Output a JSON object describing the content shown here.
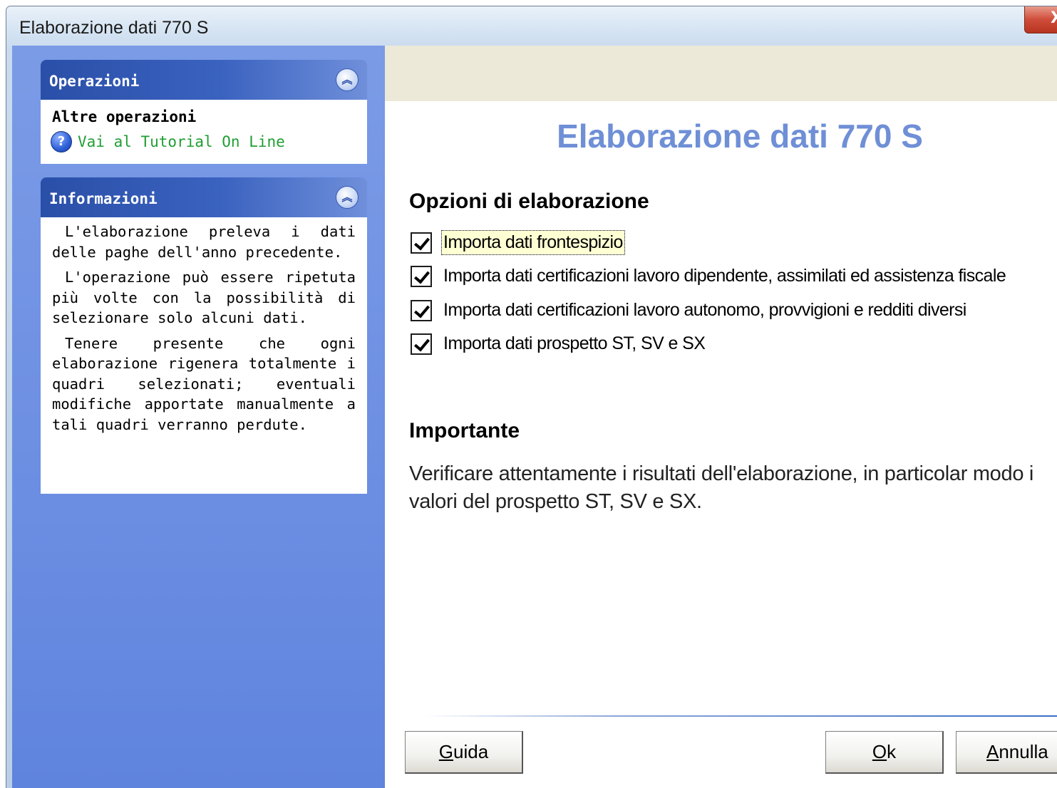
{
  "window": {
    "title": "Elaborazione dati 770 S",
    "close_label": "X"
  },
  "sidebar": {
    "operations": {
      "header": "Operazioni",
      "collapse_symbol": "︽",
      "heading": "Altre operazioni",
      "link_icon": "?",
      "link_label": "Vai al Tutorial On Line"
    },
    "information": {
      "header": "Informazioni",
      "collapse_symbol": "︽",
      "paragraphs": [
        "L'elaborazione preleva i dati delle paghe dell'anno precedente.",
        "L'operazione può essere ripetuta più volte con la possibilità di selezionare solo alcuni dati.",
        "Tenere presente che ogni elaborazione rigenera totalmente i quadri selezionati; eventuali modifiche apportate manualmente a tali quadri verranno perdute."
      ]
    }
  },
  "main": {
    "title": "Elaborazione dati 770 S",
    "options_title": "Opzioni di elaborazione",
    "options": [
      {
        "label": "Importa dati frontespizio",
        "checked": true
      },
      {
        "label": "Importa dati certificazioni lavoro dipendente, assimilati ed assistenza fiscale",
        "checked": true
      },
      {
        "label": "Importa dati certificazioni lavoro autonomo, provvigioni e redditi diversi",
        "checked": true
      },
      {
        "label": "Importa dati prospetto ST, SV e SX",
        "checked": true
      }
    ],
    "important_title": "Importante",
    "important_text": "Verificare attentamente i risultati dell'elaborazione, in particolar modo i valori del prospetto ST, SV e SX."
  },
  "buttons": {
    "help": {
      "mnemonic": "G",
      "rest": "uida"
    },
    "ok": {
      "mnemonic": "O",
      "rest": "k"
    },
    "cancel": {
      "mnemonic": "A",
      "rest": "nnulla"
    }
  },
  "colors": {
    "title_accent": "#6f8fd6",
    "link_green": "#1f9e33",
    "pane_blue": "#6c8ee2"
  }
}
